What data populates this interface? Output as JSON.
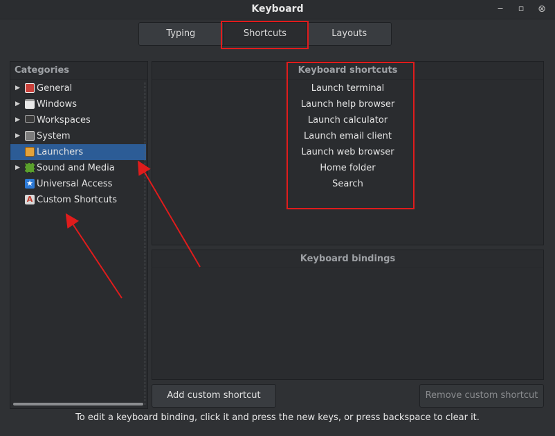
{
  "window": {
    "title": "Keyboard",
    "minimize_glyph": "‒",
    "maximize_glyph": "▫",
    "close_glyph": "⊗"
  },
  "tabs": [
    {
      "label": "Typing"
    },
    {
      "label": "Shortcuts"
    },
    {
      "label": "Layouts"
    }
  ],
  "categories": {
    "header": "Categories",
    "items": [
      {
        "label": "General",
        "expandable": true,
        "icon": "general-icon",
        "color": "#c9413b"
      },
      {
        "label": "Windows",
        "expandable": true,
        "icon": "windows-icon",
        "color": "#e8e8e8"
      },
      {
        "label": "Workspaces",
        "expandable": true,
        "icon": "workspaces-icon",
        "color": "#3a3a3a"
      },
      {
        "label": "System",
        "expandable": true,
        "icon": "system-icon",
        "color": "#7c7c7c"
      },
      {
        "label": "Launchers",
        "expandable": false,
        "icon": "launchers-icon",
        "color": "#e3a23a"
      },
      {
        "label": "Sound and Media",
        "expandable": true,
        "icon": "sound-media-icon",
        "color": "#5aa02c"
      },
      {
        "label": "Universal Access",
        "expandable": false,
        "icon": "universal-access-icon",
        "color": "#2d7ad6"
      },
      {
        "label": "Custom Shortcuts",
        "expandable": false,
        "icon": "custom-shortcuts-icon",
        "color": "#d9d9d9"
      }
    ]
  },
  "shortcuts": {
    "header": "Keyboard shortcuts",
    "items": [
      "Launch terminal",
      "Launch help browser",
      "Launch calculator",
      "Launch email client",
      "Launch web browser",
      "Home folder",
      "Search"
    ]
  },
  "bindings": {
    "header": "Keyboard bindings"
  },
  "buttons": {
    "add": "Add custom shortcut",
    "remove": "Remove custom shortcut"
  },
  "status": "To edit a keyboard binding, click it and press the new keys, or press backspace to clear it.",
  "colors": {
    "selection": "#2c5c96",
    "annotation": "#e01c1c"
  }
}
